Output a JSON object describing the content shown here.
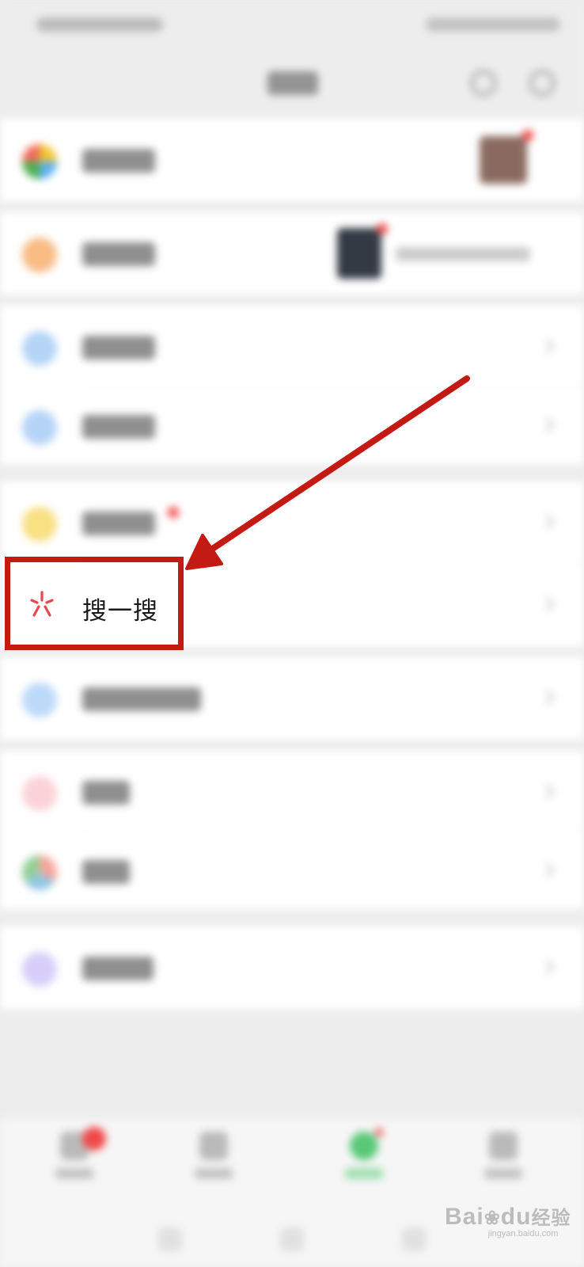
{
  "focused_item": {
    "label": "搜一搜",
    "icon": "search-one-icon",
    "icon_color": "#e5484d"
  },
  "annotation": {
    "highlight_color": "#c41a14",
    "arrow_color": "#c41a14"
  },
  "background": {
    "blurred": true,
    "row_count": 11,
    "icon_colors": [
      "#4caf50",
      "#f5a050",
      "#5aa0ee",
      "#5aa0ee",
      "#f4cc30",
      "#e5484d",
      "#5aa0ee",
      "#f08090",
      "#4aa0d0",
      "#9a88f0"
    ]
  },
  "watermark": {
    "brand": "Bai",
    "brand_tail": "du",
    "suffix": "经验",
    "url": "jingyan.baidu.com"
  }
}
